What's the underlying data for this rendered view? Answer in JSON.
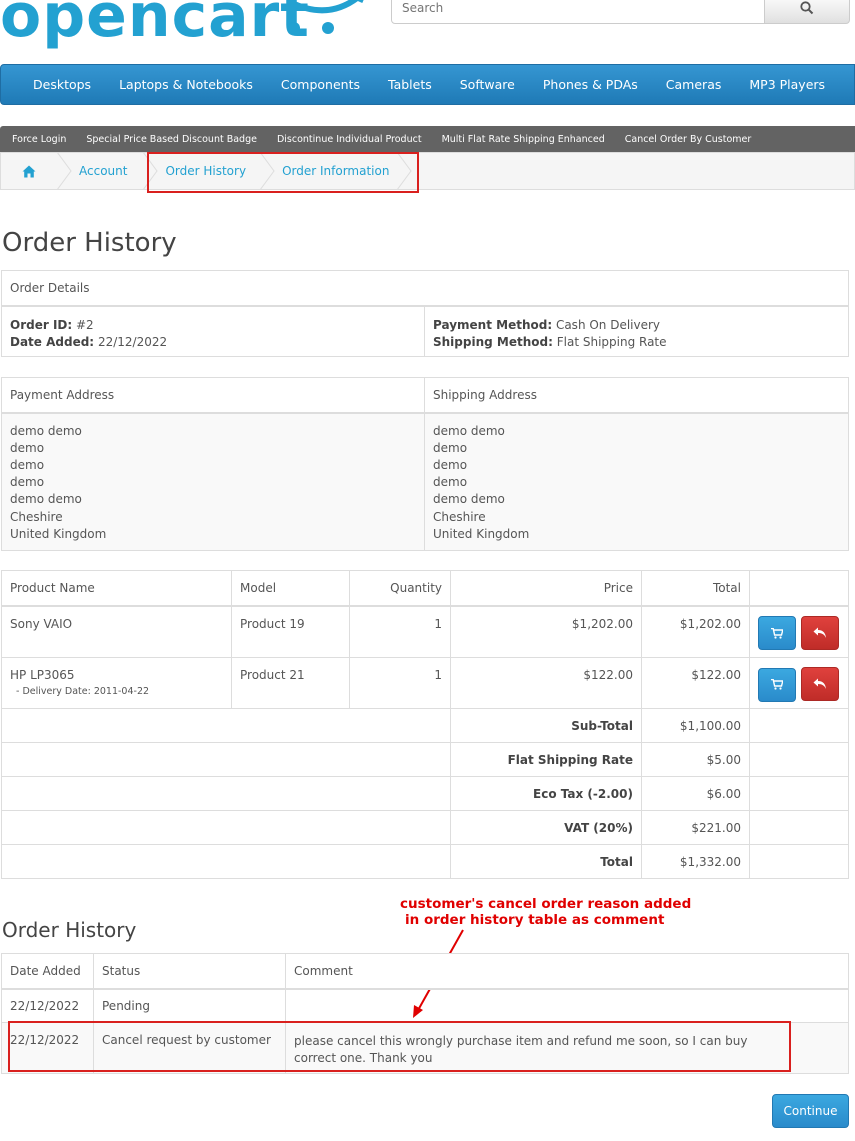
{
  "header": {
    "logo_text": "opencart",
    "search_placeholder": "Search"
  },
  "main_nav": [
    "Desktops",
    "Laptops & Notebooks",
    "Components",
    "Tablets",
    "Software",
    "Phones & PDAs",
    "Cameras",
    "MP3 Players"
  ],
  "sub_nav": [
    "Force Login",
    "Special Price Based Discount Badge",
    "Discontinue Individual Product",
    "Multi Flat Rate Shipping Enhanced",
    "Cancel Order By Customer"
  ],
  "breadcrumb": {
    "home_icon": "home-icon",
    "items": [
      "Account",
      "Order History",
      "Order Information"
    ]
  },
  "page_title": "Order History",
  "order_details": {
    "heading": "Order Details",
    "order_id_label": "Order ID:",
    "order_id": "#2",
    "date_added_label": "Date Added:",
    "date_added": "22/12/2022",
    "payment_method_label": "Payment Method:",
    "payment_method": "Cash On Delivery",
    "shipping_method_label": "Shipping Method:",
    "shipping_method": "Flat Shipping Rate"
  },
  "addresses": {
    "payment_heading": "Payment Address",
    "shipping_heading": "Shipping Address",
    "payment_lines": [
      "demo demo",
      "demo",
      "demo",
      "demo",
      "demo demo",
      "Cheshire",
      "United Kingdom"
    ],
    "shipping_lines": [
      "demo demo",
      "demo",
      "demo",
      "demo",
      "demo demo",
      "Cheshire",
      "United Kingdom"
    ]
  },
  "products": {
    "headers": [
      "Product Name",
      "Model",
      "Quantity",
      "Price",
      "Total"
    ],
    "rows": [
      {
        "name": "Sony VAIO",
        "option": "",
        "model": "Product 19",
        "qty": "1",
        "price": "$1,202.00",
        "total": "$1,202.00"
      },
      {
        "name": "HP LP3065",
        "option": "- Delivery Date: 2011-04-22",
        "model": "Product 21",
        "qty": "1",
        "price": "$122.00",
        "total": "$122.00"
      }
    ],
    "totals": [
      {
        "label": "Sub-Total",
        "value": "$1,100.00"
      },
      {
        "label": "Flat Shipping Rate",
        "value": "$5.00"
      },
      {
        "label": "Eco Tax (-2.00)",
        "value": "$6.00"
      },
      {
        "label": "VAT (20%)",
        "value": "$221.00"
      },
      {
        "label": "Total",
        "value": "$1,332.00"
      }
    ]
  },
  "history": {
    "title": "Order History",
    "headers": [
      "Date Added",
      "Status",
      "Comment"
    ],
    "rows": [
      {
        "date": "22/12/2022",
        "status": "Pending",
        "comment": ""
      },
      {
        "date": "22/12/2022",
        "status": "Cancel request by customer",
        "comment": "please cancel this wrongly purchase item and refund me soon, so I can buy correct one. Thank you"
      }
    ]
  },
  "annotation": {
    "line1": "customer's cancel order reason added",
    "line2": "in order history table as comment"
  },
  "continue_label": "Continue",
  "colors": {
    "accent": "#23a1d1",
    "highlight": "#d9201e"
  }
}
